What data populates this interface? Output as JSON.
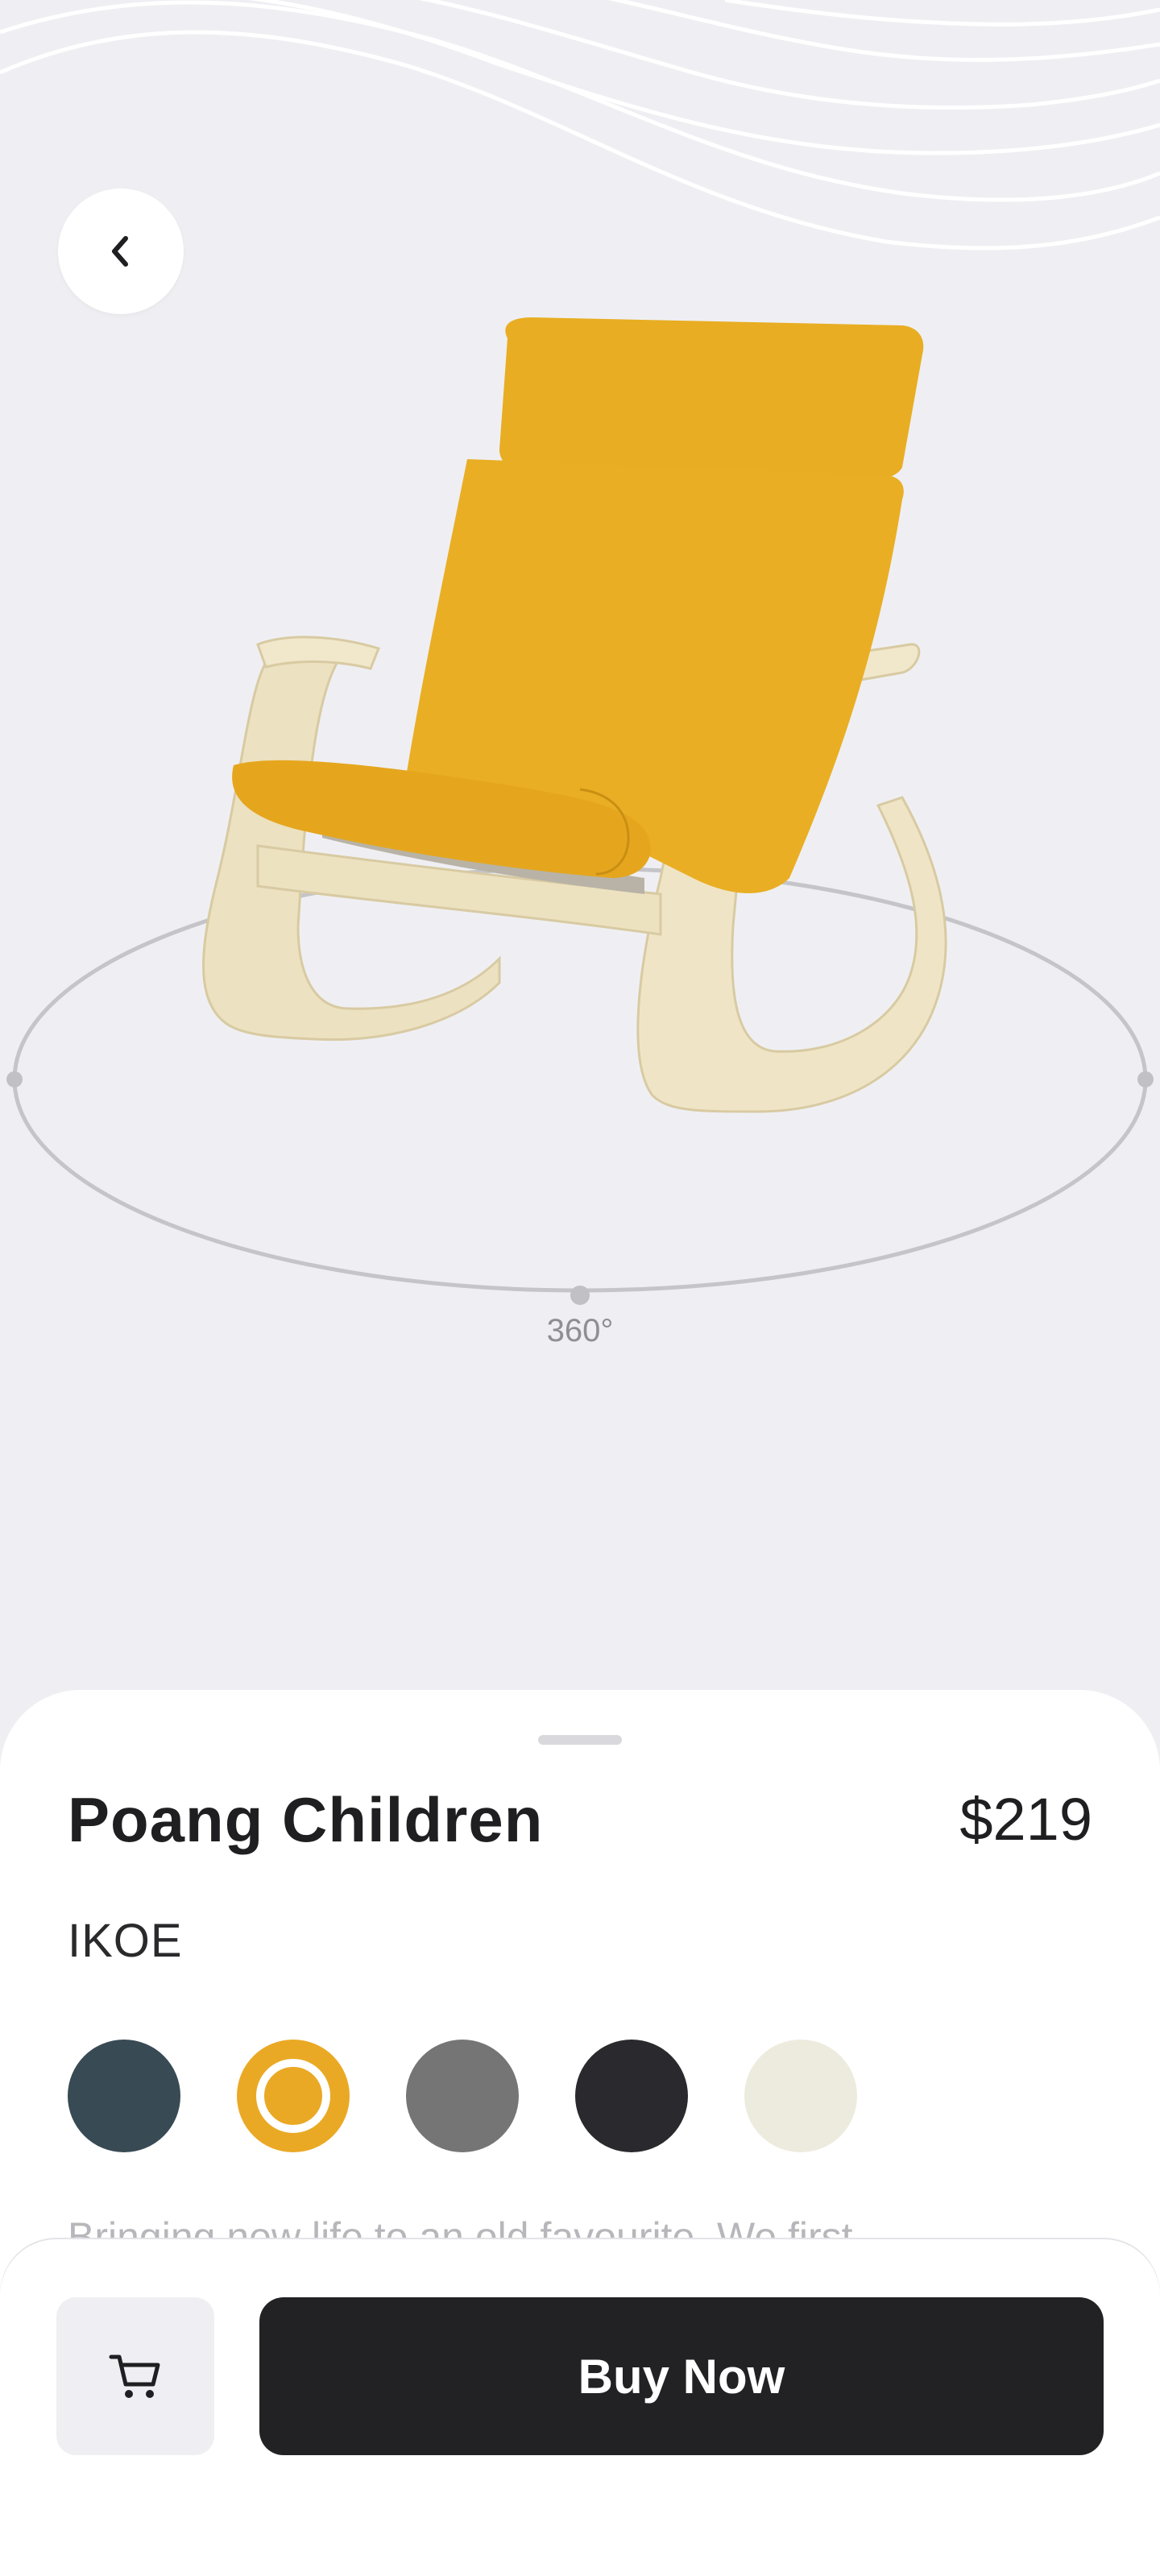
{
  "nav": {
    "back_icon": "chevron-left-icon"
  },
  "viewer": {
    "rotation_label": "360°"
  },
  "product": {
    "name": "Poang Children",
    "price": "$219",
    "brand": "IKOE",
    "description": "Bringing new life to an old favourite. We first",
    "colors": [
      {
        "name": "slate",
        "hex": "#384a54",
        "selected": false
      },
      {
        "name": "mustard",
        "hex": "#eaa925",
        "selected": true
      },
      {
        "name": "gray",
        "hex": "#757575",
        "selected": false
      },
      {
        "name": "charcoal",
        "hex": "#2a2a2e",
        "selected": false
      },
      {
        "name": "cream",
        "hex": "#edebde",
        "selected": false
      }
    ]
  },
  "actions": {
    "cart_icon": "cart-icon",
    "buy_label": "Buy Now"
  }
}
